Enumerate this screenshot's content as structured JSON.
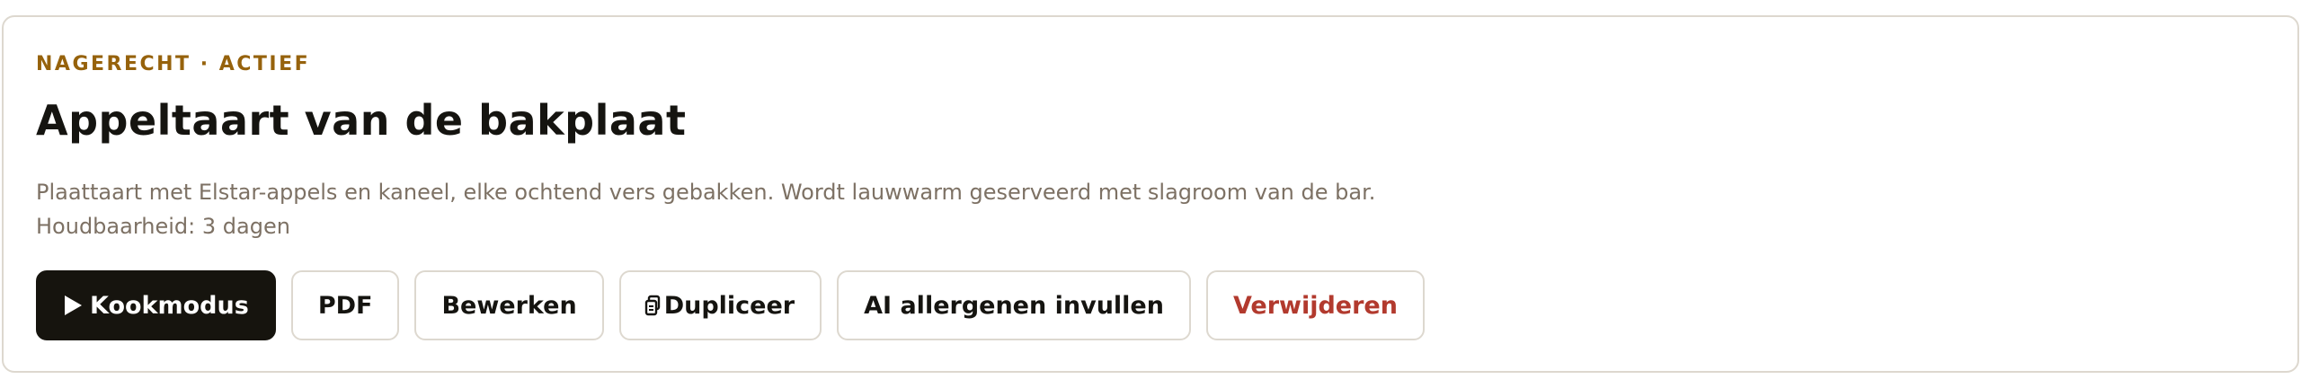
{
  "recipe": {
    "category": "NAGERECHT · ACTIEF",
    "title": "Appeltaart van de bakplaat",
    "description": "Plaattaart met Elstar-appels en kaneel, elke ochtend vers gebakken. Wordt lauwwarm geserveerd met slagroom van de bar.",
    "shelf_life": "Houdbaarheid: 3 dagen"
  },
  "actions": {
    "cook_mode": {
      "label": "Kookmodus",
      "icon": "play-icon"
    },
    "pdf": {
      "label": "PDF"
    },
    "edit": {
      "label": "Bewerken"
    },
    "duplicate": {
      "label": "Dupliceer",
      "icon": "copy-icon"
    },
    "ai_allergens": {
      "label": "AI allergenen invullen"
    },
    "delete": {
      "label": "Verwijderen"
    }
  },
  "colors": {
    "accent": "#96620c",
    "primary_button": "#16140e",
    "danger": "#b23a2e",
    "muted_text": "#7d7164",
    "border": "#ddd8cf"
  }
}
